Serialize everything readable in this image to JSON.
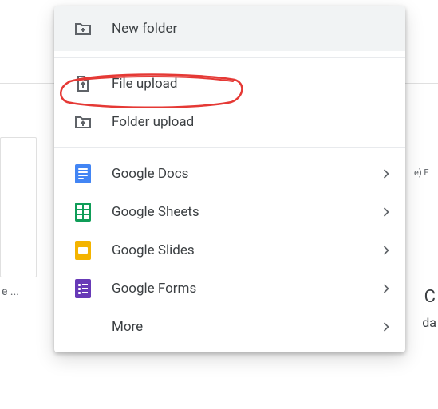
{
  "menu": {
    "new_folder": {
      "label": "New folder",
      "icon": "folder-plus-icon"
    },
    "file_upload": {
      "label": "File upload",
      "icon": "file-upload-icon"
    },
    "folder_upload": {
      "label": "Folder upload",
      "icon": "folder-upload-icon"
    },
    "docs": {
      "label": "Google Docs",
      "icon": "google-docs-icon",
      "color": "#4285f4"
    },
    "sheets": {
      "label": "Google Sheets",
      "icon": "google-sheets-icon",
      "color": "#0f9d58"
    },
    "slides": {
      "label": "Google Slides",
      "icon": "google-slides-icon",
      "color": "#f4b400"
    },
    "forms": {
      "label": "Google Forms",
      "icon": "google-forms-icon",
      "color": "#673ab7"
    },
    "more": {
      "label": "More"
    }
  },
  "annotation": {
    "target": "file_upload",
    "color": "#e53935"
  },
  "background": {
    "card_ellipsis": "e ...",
    "right_snippet_1": "e) F",
    "right_snippet_2": "C",
    "right_snippet_3": "da"
  }
}
